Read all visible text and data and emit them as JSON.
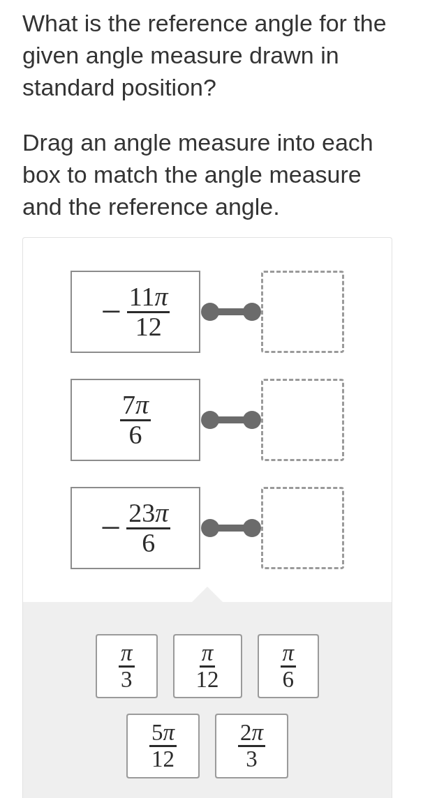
{
  "question": {
    "prompt": "What is the reference angle for the given angle measure drawn in standard position?",
    "instruction": "Drag an angle measure into each box to match the angle measure and the reference angle."
  },
  "matches": [
    {
      "angle": {
        "sign": "−",
        "coefficient": "11",
        "symbol": "π",
        "denominator": "12"
      }
    },
    {
      "angle": {
        "coefficient": "7",
        "symbol": "π",
        "denominator": "6"
      }
    },
    {
      "angle": {
        "sign": "−",
        "coefficient": "23",
        "symbol": "π",
        "denominator": "6"
      }
    }
  ],
  "answer_bank": {
    "tiles": [
      {
        "symbol": "π",
        "denominator": "3"
      },
      {
        "symbol": "π",
        "denominator": "12"
      },
      {
        "symbol": "π",
        "denominator": "6"
      },
      {
        "coefficient": "5",
        "symbol": "π",
        "denominator": "12"
      },
      {
        "coefficient": "2",
        "symbol": "π",
        "denominator": "3"
      }
    ]
  }
}
